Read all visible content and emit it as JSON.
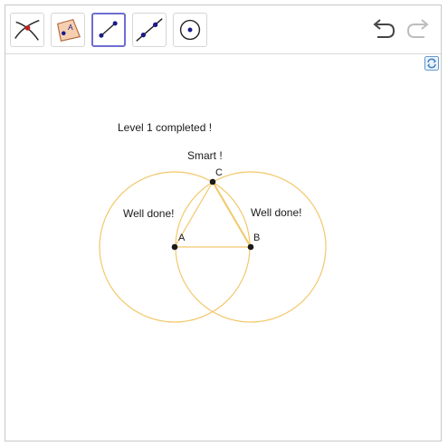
{
  "toolbar": {
    "tools": [
      {
        "name": "intersect",
        "icon": "intersect-icon",
        "selected": false
      },
      {
        "name": "point-on-object",
        "icon": "point-on-object-icon",
        "selected": false
      },
      {
        "name": "segment",
        "icon": "segment-icon",
        "selected": true
      },
      {
        "name": "line",
        "icon": "line-icon",
        "selected": false
      },
      {
        "name": "circle-center-point",
        "icon": "circle-icon",
        "selected": false
      }
    ],
    "undo_icon": "undo-icon",
    "redo_icon": "redo-icon",
    "refresh_icon": "refresh-icon",
    "selected_color": "#6e6ed0"
  },
  "canvas": {
    "level_text": "Level 1 completed !",
    "smart_text": "Smart !",
    "well_done_left": "Well done!",
    "well_done_right": "Well done!",
    "points": [
      {
        "label": "A"
      },
      {
        "label": "B"
      },
      {
        "label": "C"
      }
    ],
    "circle_color": "#f2c86a",
    "segment_color": "#f2c86a",
    "point_color": "#1a1a1a"
  }
}
